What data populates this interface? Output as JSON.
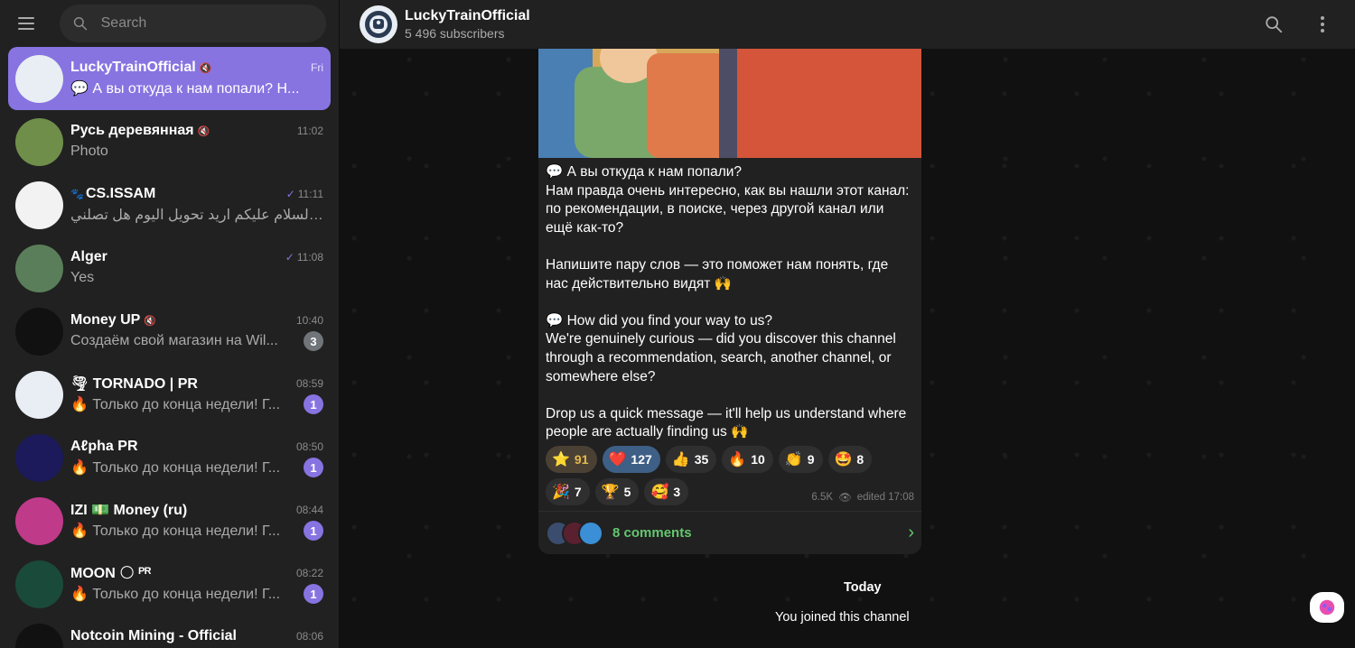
{
  "search": {
    "placeholder": "Search"
  },
  "chats": [
    {
      "name": "LuckyTrainOfficial",
      "muted": true,
      "time": "Fri",
      "message": "💬 А вы откуда к нам попали? Н...",
      "active": true,
      "avatar_color": "#e8eef4"
    },
    {
      "name": "Русь деревянная",
      "muted": true,
      "time": "11:02",
      "message": "Photo",
      "avatar_color": "#6f8e4a"
    },
    {
      "name": "CS.ISSAM",
      "prefix": "🐾",
      "check": true,
      "time": "11:11",
      "message": "السلام عليكم اريد تحويل اليوم هل تصلني ...",
      "avatar_color": "#f2f2f2"
    },
    {
      "name": "Alger",
      "check": true,
      "time": "11:08",
      "message": "Yes",
      "avatar_color": "#5b7e5a"
    },
    {
      "name": "Money UP",
      "muted": true,
      "time": "10:40",
      "message": "Создаём свой магазин на Wil...",
      "unread": "3",
      "unread_muted": true,
      "avatar_color": "#111"
    },
    {
      "name": "🌪 TORNADO | PR",
      "time": "08:59",
      "message": "🔥 Только до конца недели! Г...",
      "unread": "1",
      "avatar_color": "#e9eef4"
    },
    {
      "name": "Aℓpha PR",
      "time": "08:50",
      "message": "🔥 Только до конца недели! Г...",
      "unread": "1",
      "avatar_color": "#1c1a5a"
    },
    {
      "name": "IZI 💵 Money (ru)",
      "time": "08:44",
      "message": "🔥 Только до конца недели! Г...",
      "unread": "1",
      "avatar_color": "#c03a8a"
    },
    {
      "name": "MOON 🌕 ᴾᴿ",
      "time": "08:22",
      "message": "🔥 Только до конца недели! Г...",
      "unread": "1",
      "avatar_color": "#1a4a3a"
    },
    {
      "name": "Notcoin Mining - Official",
      "time": "08:06",
      "message": "",
      "avatar_color": "#111"
    }
  ],
  "header": {
    "title": "LuckyTrainOfficial",
    "subtitle": "5 496 subscribers"
  },
  "post": {
    "text_ru_title": "💬 А вы откуда к нам попали?",
    "text_ru_body": "Нам правда очень интересно, как вы нашли этот канал: по рекомендации, в поиске, через другой канал или ещё как-то?",
    "text_ru_call": "Напишите пару слов — это поможет нам понять, где нас действительно видят 🙌",
    "text_en_title": "💬 How did you find your way to us?",
    "text_en_body": "We're genuinely curious — did you discover this channel through a recommendation, search, another channel, or somewhere else?",
    "text_en_call": "Drop us a quick message — it'll help us understand where people are actually finding us 🙌",
    "reactions": [
      {
        "emoji": "⭐",
        "count": "91",
        "style": "mine"
      },
      {
        "emoji": "❤️",
        "count": "127",
        "style": "chosen"
      },
      {
        "emoji": "👍",
        "count": "35"
      },
      {
        "emoji": "🔥",
        "count": "10"
      },
      {
        "emoji": "👏",
        "count": "9"
      },
      {
        "emoji": "🤩",
        "count": "8"
      },
      {
        "emoji": "🎉",
        "count": "7"
      },
      {
        "emoji": "🏆",
        "count": "5"
      },
      {
        "emoji": "🥰",
        "count": "3"
      }
    ],
    "views": "6.5K",
    "edited": "edited 17:08",
    "comments": "8 comments"
  },
  "day_label": "Today",
  "service_message": "You joined this channel",
  "colors": {
    "accent": "#8774e1",
    "comments": "#63c76f",
    "sidebar": "#212121"
  }
}
